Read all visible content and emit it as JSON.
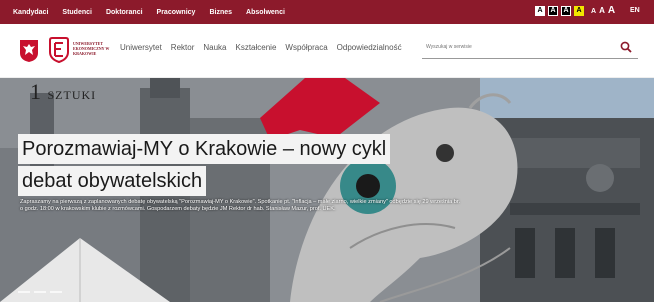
{
  "topbar": {
    "links": [
      "Kandydaci",
      "Studenci",
      "Doktoranci",
      "Pracownicy",
      "Biznes",
      "Absolwenci"
    ],
    "contrast_buttons": [
      "A",
      "A",
      "A",
      "A"
    ],
    "font_size_labels": [
      "A",
      "A",
      "A"
    ],
    "language": "EN"
  },
  "header": {
    "logo_text": "UNIWERSYTET EKONOMICZNY W KRAKOWIE",
    "nav": [
      "Uniwersytet",
      "Rektor",
      "Nauka",
      "Kształcenie",
      "Współpraca",
      "Odpowiedzialność"
    ],
    "search_placeholder": "Wyszukaj w serwisie"
  },
  "hero": {
    "tag": "1",
    "tag_word": "SZTUKI",
    "title_line1": "Porozmawiaj-MY o Krakowie – nowy cykl",
    "title_line2": "debat obywatelskich",
    "description": "Zapraszamy na pierwszą z zaplanowanych debatę obywatelską \"Porozmawiaj-MY o Krakowie\". Spotkanie pt. \"Inflacja – małe ziarno, wielkie zmiany\" odbędzie się 29 września br. o godz. 18:00 w krakowskim klubie z rozmówcami. Gospodarzem debaty będzie JM Rektor dr hab. Stanisław Mazur, prof. UEK."
  },
  "colors": {
    "brand": "#8c1a2b",
    "accent_red": "#c8102e"
  },
  "icons": [
    "polish-eagle-icon",
    "uek-logo-icon",
    "search-icon"
  ]
}
